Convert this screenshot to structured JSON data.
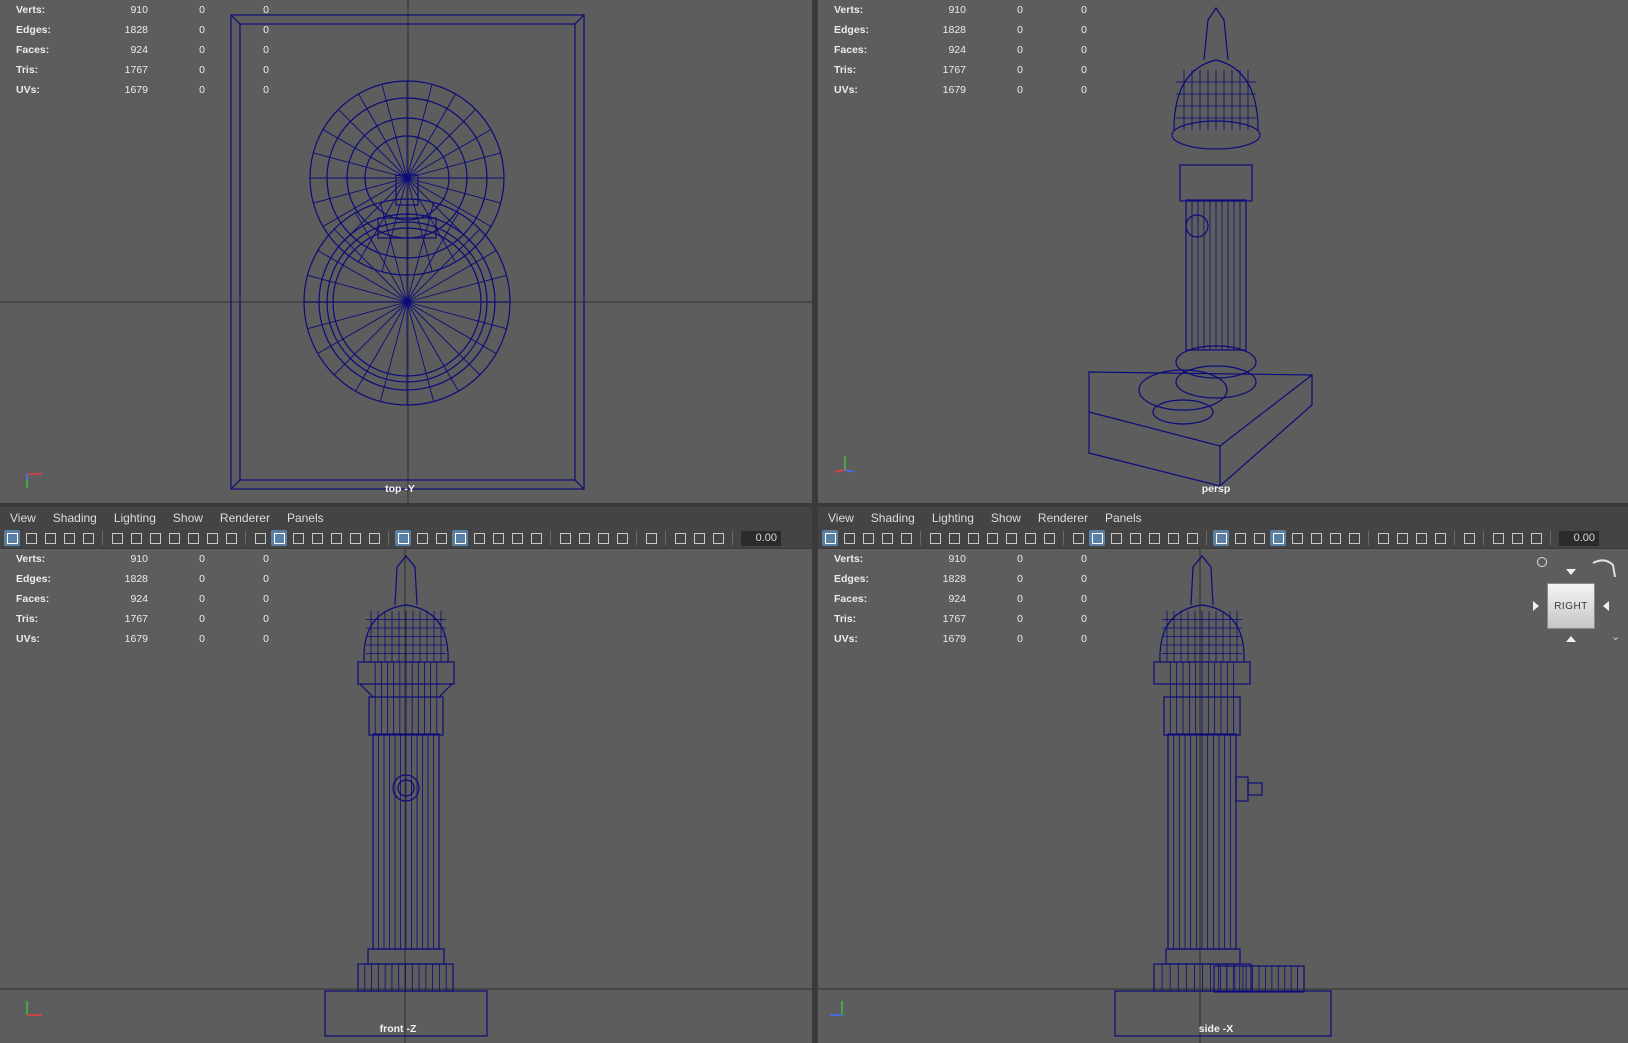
{
  "stats": {
    "rows": [
      {
        "label": "Verts:",
        "v1": "910",
        "v2": "0",
        "v3": "0"
      },
      {
        "label": "Edges:",
        "v1": "1828",
        "v2": "0",
        "v3": "0"
      },
      {
        "label": "Faces:",
        "v1": "924",
        "v2": "0",
        "v3": "0"
      },
      {
        "label": "Tris:",
        "v1": "1767",
        "v2": "0",
        "v3": "0"
      },
      {
        "label": "UVs:",
        "v1": "1679",
        "v2": "0",
        "v3": "0"
      }
    ]
  },
  "cameras": {
    "top": "top -Y",
    "persp": "persp",
    "front": "front -Z",
    "side": "side -X"
  },
  "menu": {
    "items": [
      "View",
      "Shading",
      "Lighting",
      "Show",
      "Renderer",
      "Panels"
    ]
  },
  "toolbar": {
    "value": "0.00"
  },
  "viewcube": {
    "label": "RIGHT"
  },
  "axes": {
    "x": "x",
    "y": "y",
    "z": "z"
  },
  "colors": {
    "viewport_bg": "#5d5d5d",
    "wire": "#0b0b7a",
    "panel_bg": "#444444",
    "active_button": "#5a7fa3"
  }
}
